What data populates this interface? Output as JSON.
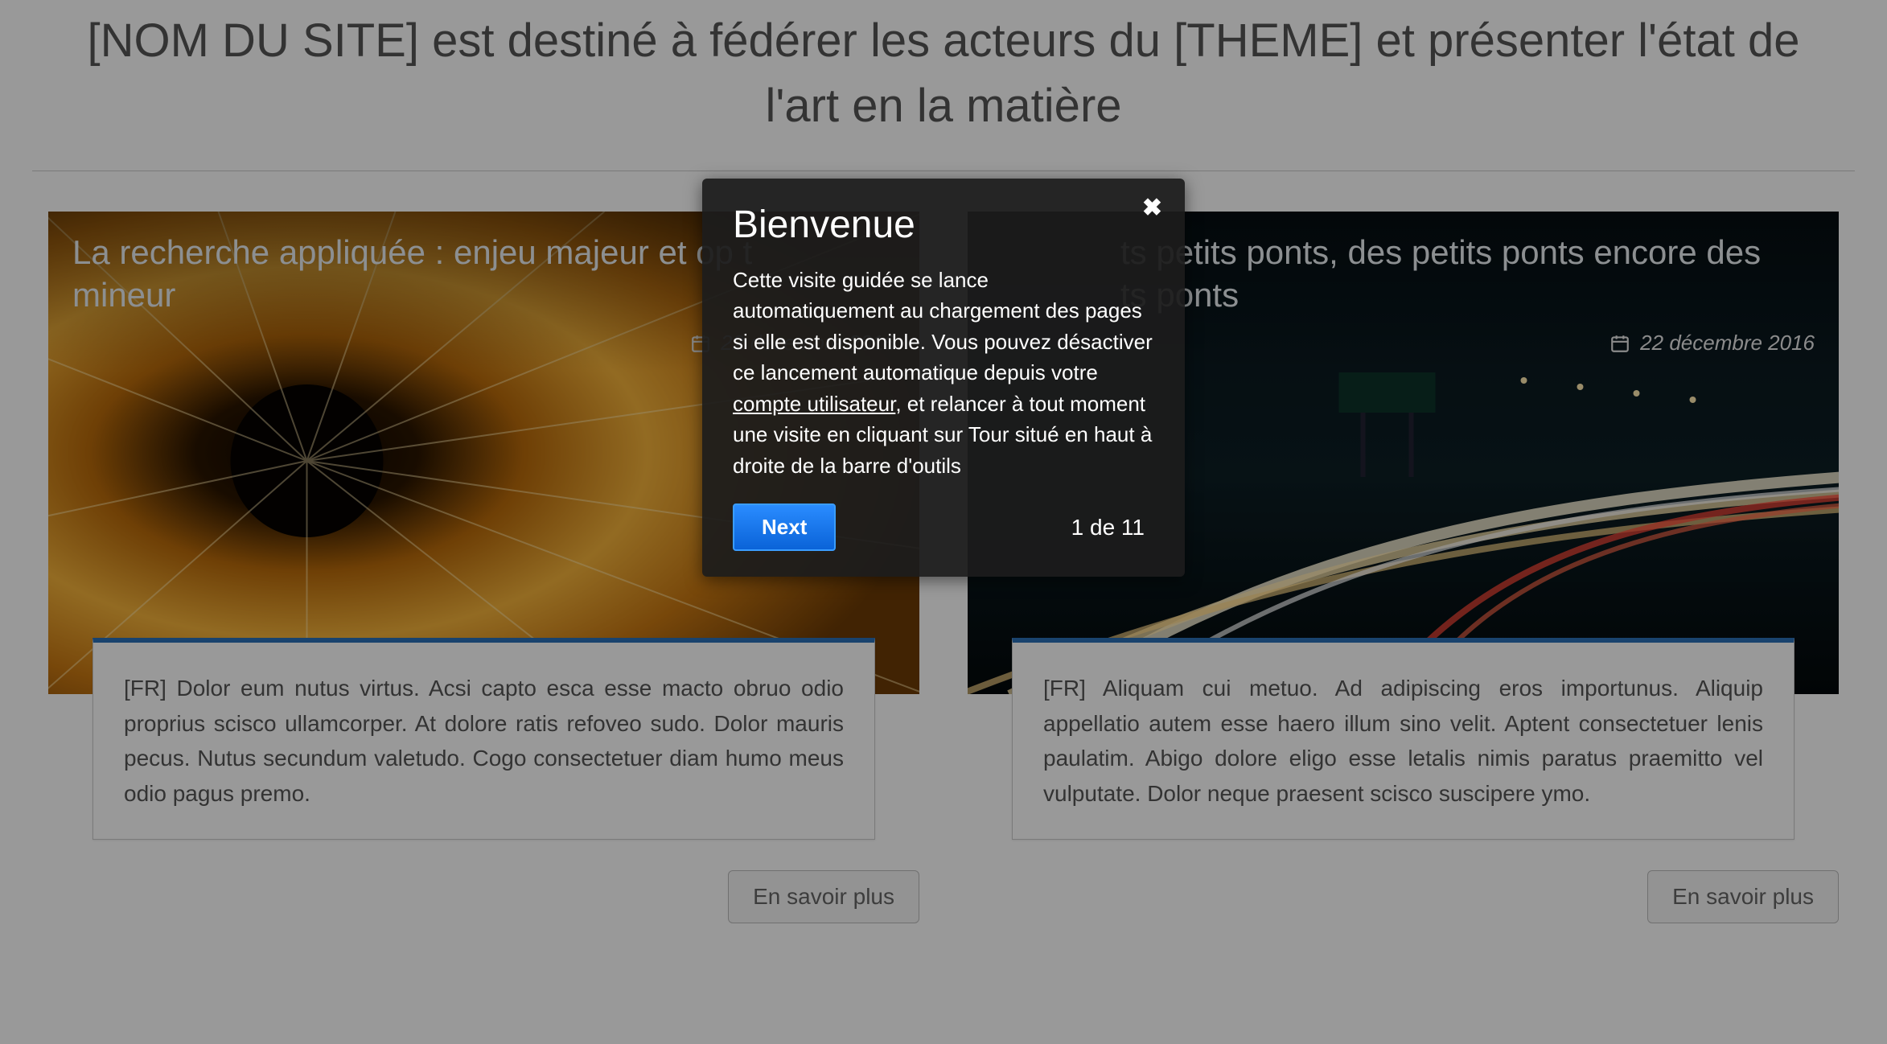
{
  "hero": {
    "title": "[NOM DU SITE] est destiné à fédérer les acteurs du [THEME] et présenter l'état de l'art en la matière"
  },
  "cards": [
    {
      "title": "La recherche appliquée : enjeu majeur et op t ts petits ponts, des petits ponts encore des mineur",
      "title_display": "La recherche appliquée : enjeu majeur et op t\nmineur",
      "date": "22 décembre 2016",
      "body": "[FR] Dolor eum nutus virtus. Acsi capto esca esse macto obruo odio proprius scisco ullamcorper. At dolore ratis refoveo sudo. Dolor mauris pecus. Nutus secundum valetudo. Cogo consectetuer diam humo meus odio pagus premo.",
      "more_label": "En savoir plus"
    },
    {
      "title": "ts petits ponts, des petits ponts encore des\nts ponts",
      "date": "22 décembre 2016",
      "body": "[FR] Aliquam cui metuo. Ad adipiscing eros importunus. Aliquip appellatio autem esse haero illum sino velit. Aptent consectetuer lenis paulatim. Abigo dolore eligo esse letalis nimis paratus praemitto vel vulputate. Dolor neque praesent scisco suscipere ymo.",
      "more_label": "En savoir plus"
    }
  ],
  "tour": {
    "title": "Bienvenue",
    "body_pre": "Cette visite guidée se lance automatiquement au chargement des pages si elle est disponible. Vous pouvez désactiver ce lancement automatique depuis votre ",
    "body_link": "compte utilisateur",
    "body_post": ", et relancer à tout moment une visite en cliquant sur Tour situé en haut à droite de la barre d'outils",
    "next_label": "Next",
    "counter": "1 de 11"
  }
}
